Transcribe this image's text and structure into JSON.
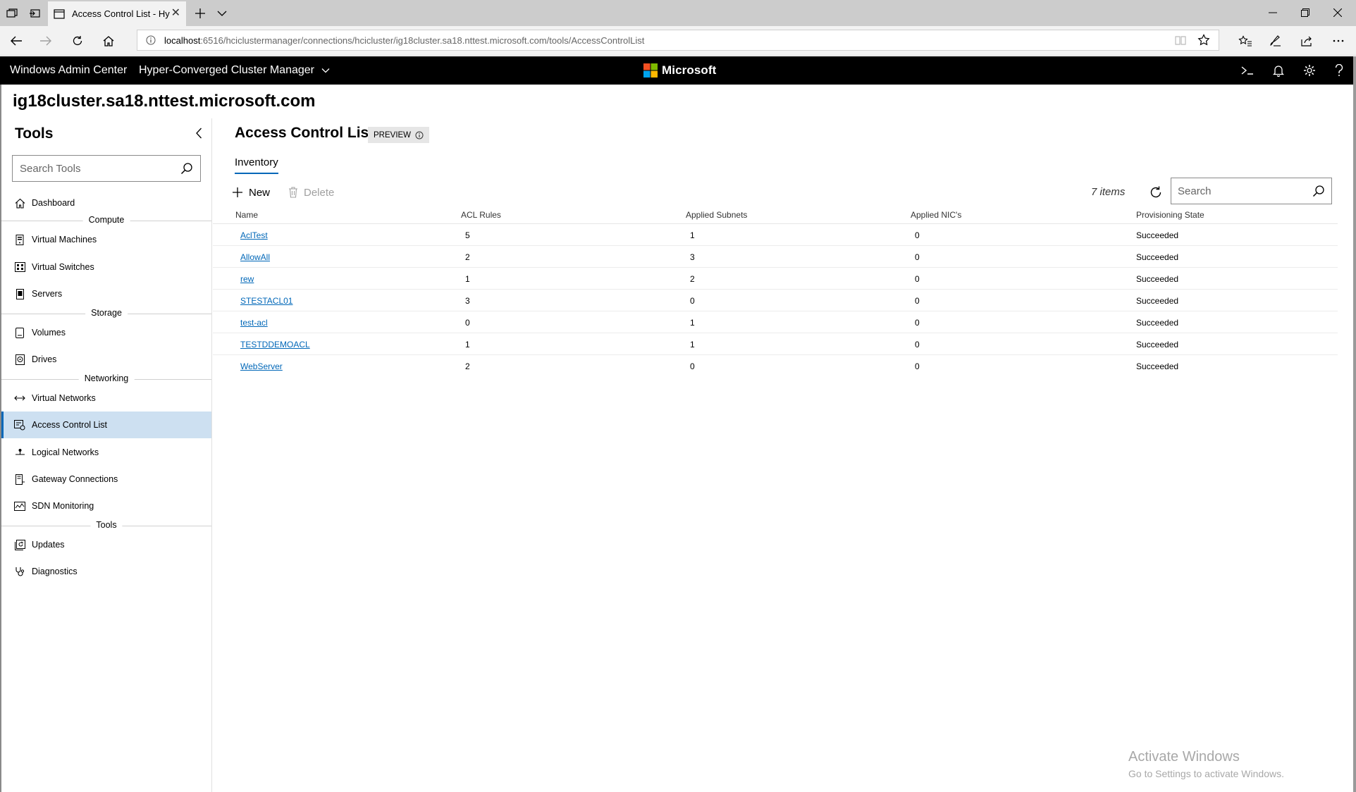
{
  "browser": {
    "tab_title": "Access Control List - Hy",
    "url_host": "localhost",
    "url_path": ":6516/hciclustermanager/connections/hcicluster/ig18cluster.sa18.nttest.microsoft.com/tools/AccessControlList"
  },
  "app": {
    "brand": "Windows Admin Center",
    "solution": "Hyper-Converged Cluster Manager",
    "vendor": "Microsoft",
    "cluster_name": "ig18cluster.sa18.nttest.microsoft.com"
  },
  "sidebar": {
    "title": "Tools",
    "search_placeholder": "Search Tools",
    "items": [
      {
        "label": "Dashboard"
      },
      {
        "label": "Virtual Machines"
      },
      {
        "label": "Virtual Switches"
      },
      {
        "label": "Servers"
      },
      {
        "label": "Volumes"
      },
      {
        "label": "Drives"
      },
      {
        "label": "Virtual Networks"
      },
      {
        "label": "Access Control List"
      },
      {
        "label": "Logical Networks"
      },
      {
        "label": "Gateway Connections"
      },
      {
        "label": "SDN Monitoring"
      },
      {
        "label": "Updates"
      },
      {
        "label": "Diagnostics"
      }
    ],
    "groups": [
      "Compute",
      "Storage",
      "Networking",
      "Tools"
    ]
  },
  "main": {
    "title": "Access Control List",
    "preview_label": "PREVIEW",
    "tab": "Inventory",
    "new_label": "New",
    "delete_label": "Delete",
    "item_count": "7 items",
    "search_placeholder": "Search",
    "columns": [
      "Name",
      "ACL Rules",
      "Applied Subnets",
      "Applied NIC's",
      "Provisioning State"
    ],
    "rows": [
      [
        "AclTest",
        "5",
        "1",
        "0",
        "Succeeded"
      ],
      [
        "AllowAll",
        "2",
        "3",
        "0",
        "Succeeded"
      ],
      [
        "rew",
        "1",
        "2",
        "0",
        "Succeeded"
      ],
      [
        "STESTACL01",
        "3",
        "0",
        "0",
        "Succeeded"
      ],
      [
        "test-acl",
        "0",
        "1",
        "0",
        "Succeeded"
      ],
      [
        "TESTDDEMOACL",
        "1",
        "1",
        "0",
        "Succeeded"
      ],
      [
        "WebServer",
        "2",
        "0",
        "0",
        "Succeeded"
      ]
    ]
  },
  "watermark": {
    "line1": "Activate Windows",
    "line2": "Go to Settings to activate Windows."
  },
  "colors": {
    "accent": "#0067b8",
    "selected_bg": "#cde0f1",
    "header_bg": "#000000"
  }
}
